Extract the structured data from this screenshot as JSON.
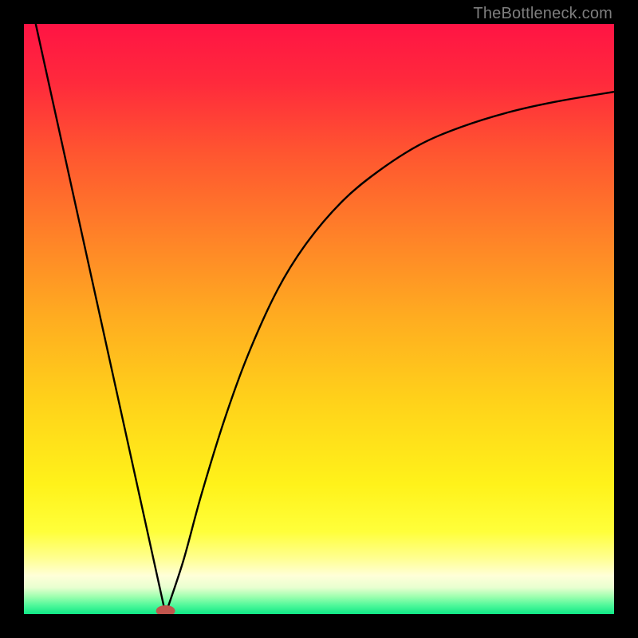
{
  "credit": "TheBottleneck.com",
  "chart_data": {
    "type": "line",
    "title": "",
    "xlabel": "",
    "ylabel": "",
    "x_range": [
      0,
      100
    ],
    "y_range": [
      0,
      100
    ],
    "optimum_x": 24,
    "marker": {
      "x": 24,
      "y": 0,
      "color": "#c1554d"
    },
    "left_segment": {
      "note": "near-linear falling limb",
      "points": [
        {
          "x": 2,
          "y": 100
        },
        {
          "x": 24,
          "y": 0
        }
      ]
    },
    "right_segment": {
      "note": "rising saturating limb",
      "points": [
        {
          "x": 24,
          "y": 0
        },
        {
          "x": 27,
          "y": 9
        },
        {
          "x": 30,
          "y": 20
        },
        {
          "x": 34,
          "y": 33
        },
        {
          "x": 38,
          "y": 44
        },
        {
          "x": 43,
          "y": 55
        },
        {
          "x": 48,
          "y": 63
        },
        {
          "x": 54,
          "y": 70
        },
        {
          "x": 60,
          "y": 75
        },
        {
          "x": 67,
          "y": 79.5
        },
        {
          "x": 74,
          "y": 82.5
        },
        {
          "x": 82,
          "y": 85
        },
        {
          "x": 90,
          "y": 86.8
        },
        {
          "x": 100,
          "y": 88.5
        }
      ]
    },
    "gradient_stops": [
      {
        "pos": 0.0,
        "color": "#ff1444"
      },
      {
        "pos": 0.5,
        "color": "#ffad20"
      },
      {
        "pos": 0.8,
        "color": "#ffff3a"
      },
      {
        "pos": 1.0,
        "color": "#10e887"
      }
    ]
  }
}
